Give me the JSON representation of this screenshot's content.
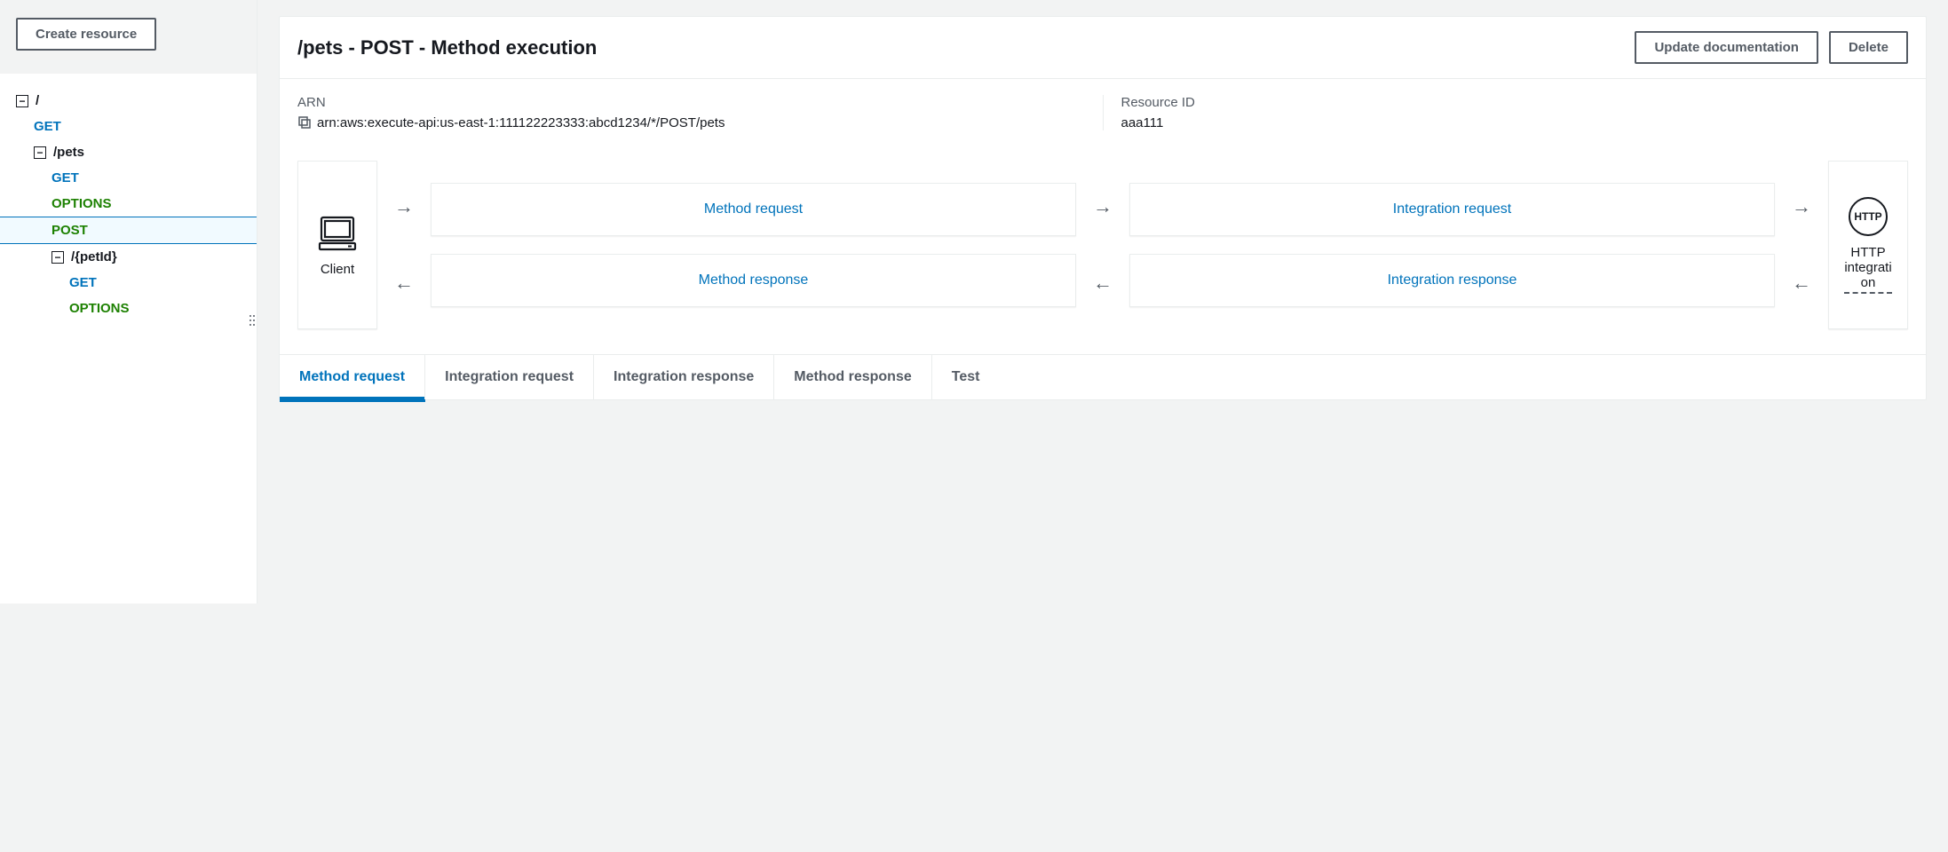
{
  "sidebar": {
    "create_resource_label": "Create resource",
    "tree": {
      "root_label": "/",
      "root_get": "GET",
      "pets_label": "/pets",
      "pets_get": "GET",
      "pets_options": "OPTIONS",
      "pets_post": "POST",
      "petid_label": "/{petId}",
      "petid_get": "GET",
      "petid_options": "OPTIONS"
    }
  },
  "header": {
    "title": "/pets - POST - Method execution",
    "update_doc_label": "Update documentation",
    "delete_label": "Delete"
  },
  "meta": {
    "arn_label": "ARN",
    "arn_value": "arn:aws:execute-api:us-east-1:111122223333:abcd1234/*/POST/pets",
    "resource_id_label": "Resource ID",
    "resource_id_value": "aaa111"
  },
  "flow": {
    "client_label": "Client",
    "method_request": "Method request",
    "integration_request": "Integration request",
    "method_response": "Method response",
    "integration_response": "Integration response",
    "http_badge": "HTTP",
    "http_line1": "HTTP",
    "http_line2": "integrati",
    "http_line3": "on"
  },
  "tabs": {
    "method_request": "Method request",
    "integration_request": "Integration request",
    "integration_response": "Integration response",
    "method_response": "Method response",
    "test": "Test"
  }
}
